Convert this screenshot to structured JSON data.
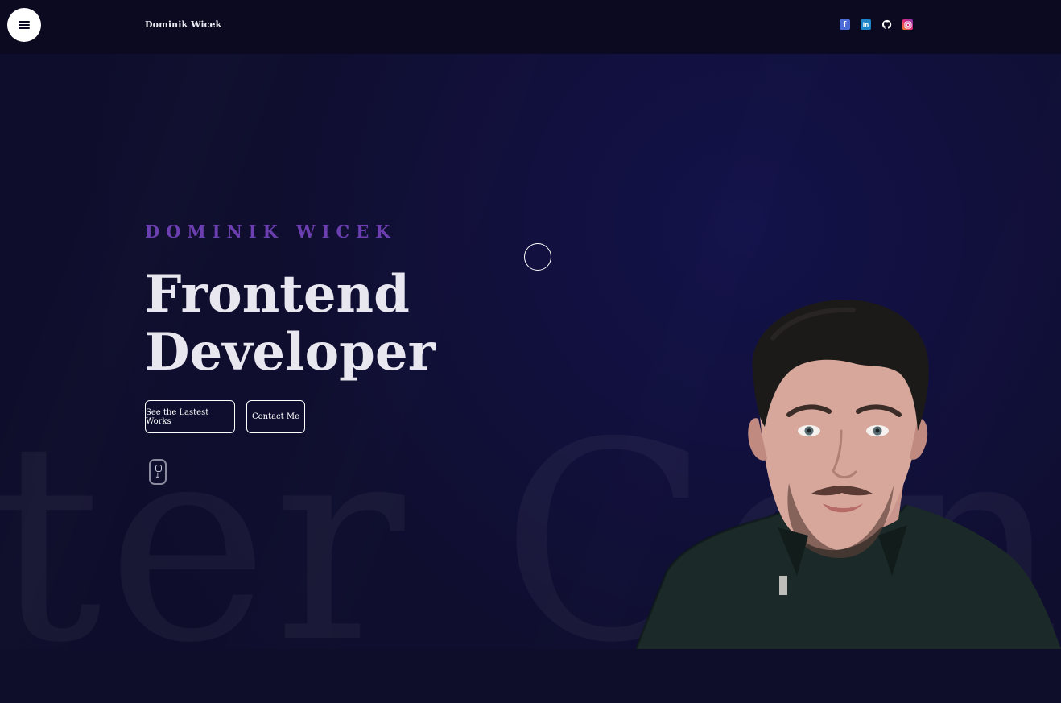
{
  "header": {
    "brand": "Dominik Wicek",
    "menu_icon": "hamburger-menu-icon",
    "socials": [
      {
        "name": "facebook-icon",
        "glyph": "f"
      },
      {
        "name": "linkedin-icon",
        "glyph": "in"
      },
      {
        "name": "github-icon",
        "glyph": "gh"
      },
      {
        "name": "instagram-icon",
        "glyph": "ig"
      }
    ]
  },
  "hero": {
    "eyebrow": "DOMINIK WICEK",
    "headline_line1": "Frontend",
    "headline_line2": "Developer",
    "background_text": "ter Con",
    "buttons": {
      "works_label": "See the Lastest Works",
      "contact_label": "Contact Me"
    },
    "scroll_icon": "mouse-scroll-down-icon"
  },
  "colors": {
    "background": "#0e0d2a",
    "accent_purple": "#6c3fb1",
    "text": "#e8e6ee"
  }
}
